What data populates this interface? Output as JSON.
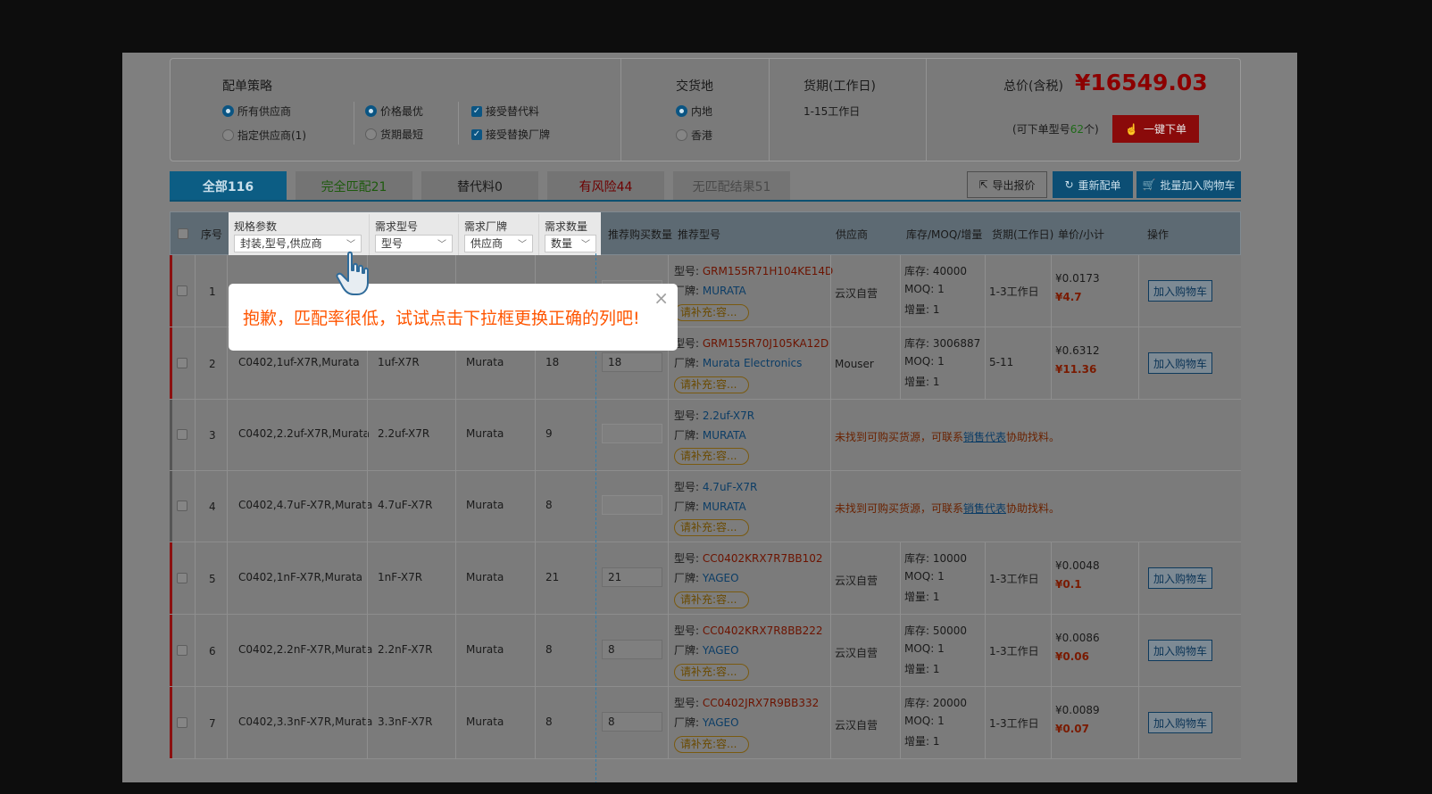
{
  "strategy": {
    "title": "配单策略",
    "supplier_all": "所有供应商",
    "supplier_specified": "指定供应商(1)",
    "best_price": "价格最优",
    "shortest_delivery": "货期最短",
    "accept_substitute": "接受替代料",
    "accept_brand_change": "接受替换厂牌"
  },
  "delivery_place": {
    "title": "交货地",
    "mainland": "内地",
    "hongkong": "香港"
  },
  "lead_time": {
    "title": "货期(工作日)",
    "value": "1-15工作日"
  },
  "total": {
    "label": "总价(含税)",
    "value": "¥16549.03",
    "orderable_prefix": "(可下单型号",
    "orderable_count": "62",
    "orderable_suffix": "个)",
    "one_click_label": "一键下单"
  },
  "tabs": [
    {
      "label": "全部116"
    },
    {
      "label": "完全匹配21"
    },
    {
      "label": "替代料0"
    },
    {
      "label": "有风险44"
    },
    {
      "label": "无匹配结果51"
    }
  ],
  "toolbar": {
    "export_label": "导出报价",
    "rematch_label": "重新配单",
    "batch_cart_label": "批量加入购物车"
  },
  "columns": {
    "index": "序号",
    "spec": "规格参数",
    "spec_select": "封装,型号,供应商",
    "req_model": "需求型号",
    "req_model_select": "型号",
    "req_brand": "需求厂牌",
    "req_brand_select": "供应商",
    "req_qty": "需求数量",
    "req_qty_select": "数量",
    "buy_qty": "推荐购买数量",
    "rec_model": "推荐型号",
    "supplier": "供应商",
    "stock": "库存/MOQ/增量",
    "lead": "货期(工作日)",
    "price": "单价/小计",
    "ops": "操作"
  },
  "labels": {
    "model_prefix": "型号: ",
    "brand_prefix": "厂牌: ",
    "fill_in": "请补充:容...",
    "stock_prefix": "库存: ",
    "moq_prefix": "MOQ: ",
    "inc_prefix": "增量: ",
    "add_cart": "加入购物车",
    "not_found_pre": "未找到可购买货源，可联系",
    "not_found_link": "销售代表",
    "not_found_post": "协助找料。"
  },
  "rows": [
    {
      "idx": "1",
      "spec": "",
      "req_model": "",
      "req_brand": "",
      "req_qty": "",
      "buy_qty": "",
      "model": "GRM155R71H104KE14D",
      "brand": "MURATA",
      "supplier": "云汉自营",
      "stock": "40000",
      "moq": "1",
      "inc": "1",
      "lead": "1-3工作日",
      "price": "¥0.0173",
      "subtotal": "¥4.7"
    },
    {
      "idx": "2",
      "spec": "C0402,1uf-X7R,Murata",
      "req_model": "1uf-X7R",
      "req_brand": "Murata",
      "req_qty": "18",
      "buy_qty": "18",
      "model": "GRM155R70J105KA12D",
      "brand": "Murata Electronics",
      "supplier": "Mouser",
      "stock": "3006887",
      "moq": "1",
      "inc": "1",
      "lead": "5-11",
      "price": "¥0.6312",
      "subtotal": "¥11.36"
    },
    {
      "idx": "3",
      "spec": "C0402,2.2uf-X7R,Murata",
      "req_model": "2.2uf-X7R",
      "req_brand": "Murata",
      "req_qty": "9",
      "buy_qty": "",
      "model": "2.2uf-X7R",
      "brand": "MURATA"
    },
    {
      "idx": "4",
      "spec": "C0402,4.7uF-X7R,Murata",
      "req_model": "4.7uF-X7R",
      "req_brand": "Murata",
      "req_qty": "8",
      "buy_qty": "",
      "model": "4.7uF-X7R",
      "brand": "MURATA"
    },
    {
      "idx": "5",
      "spec": "C0402,1nF-X7R,Murata",
      "req_model": "1nF-X7R",
      "req_brand": "Murata",
      "req_qty": "21",
      "buy_qty": "21",
      "model": "CC0402KRX7R7BB102",
      "brand": "YAGEO",
      "supplier": "云汉自营",
      "stock": "10000",
      "moq": "1",
      "inc": "1",
      "lead": "1-3工作日",
      "price": "¥0.0048",
      "subtotal": "¥0.1"
    },
    {
      "idx": "6",
      "spec": "C0402,2.2nF-X7R,Murata",
      "req_model": "2.2nF-X7R",
      "req_brand": "Murata",
      "req_qty": "8",
      "buy_qty": "8",
      "model": "CC0402KRX7R8BB222",
      "brand": "YAGEO",
      "supplier": "云汉自营",
      "stock": "50000",
      "moq": "1",
      "inc": "1",
      "lead": "1-3工作日",
      "price": "¥0.0086",
      "subtotal": "¥0.06"
    },
    {
      "idx": "7",
      "spec": "C0402,3.3nF-X7R,Murata",
      "req_model": "3.3nF-X7R",
      "req_brand": "Murata",
      "req_qty": "8",
      "buy_qty": "8",
      "model": "CC0402JRX7R9BB332",
      "brand": "YAGEO",
      "supplier": "云汉自营",
      "stock": "20000",
      "moq": "1",
      "inc": "1",
      "lead": "1-3工作日",
      "price": "¥0.0089",
      "subtotal": "¥0.07"
    }
  ],
  "tooltip": {
    "message": "抱歉，匹配率很低，试试点击下拉框更换正确的列吧!"
  },
  "colors": {
    "accent_blue": "#0b5583",
    "danger_red": "#8a0a0a",
    "hint_orange": "#ff5500"
  }
}
